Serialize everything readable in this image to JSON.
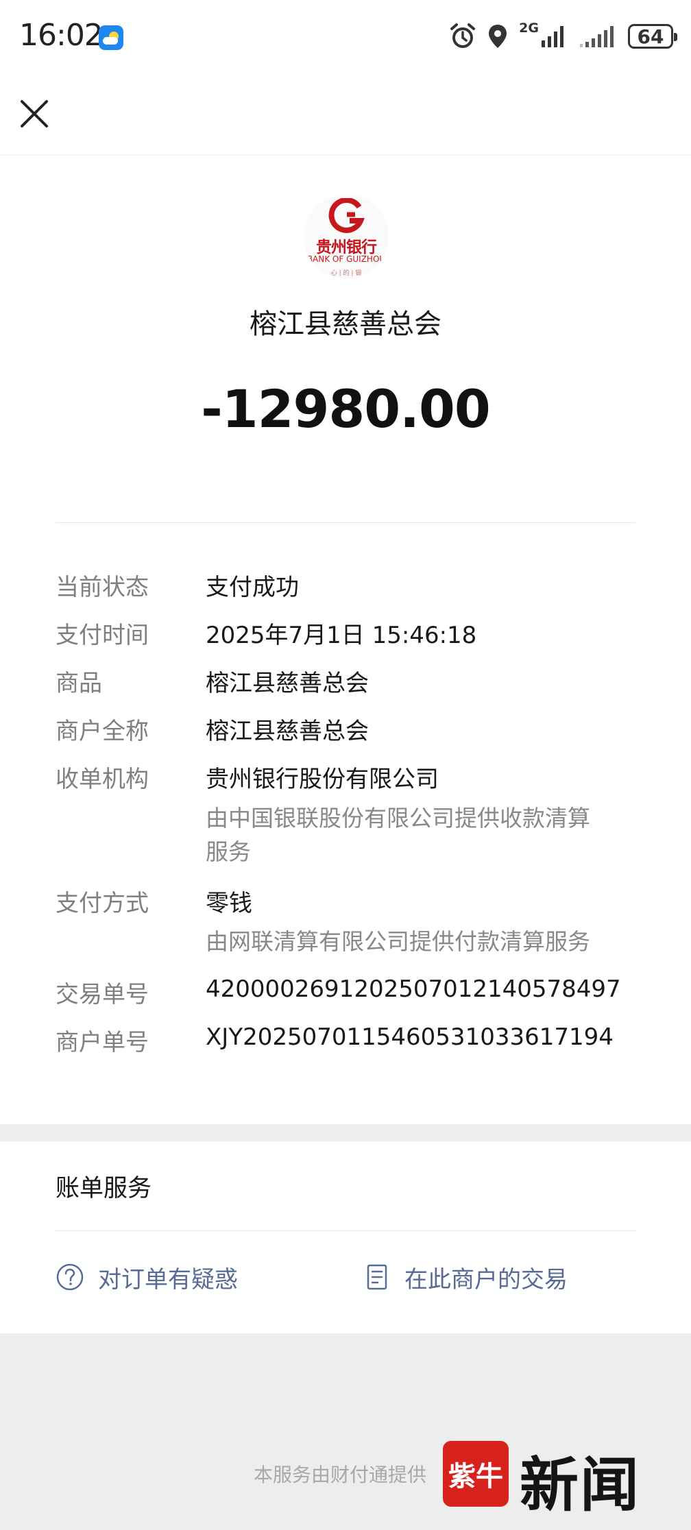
{
  "status_bar": {
    "time": "16:02",
    "network": "2G",
    "battery": "64"
  },
  "top_bar": {
    "close_icon": "close-icon"
  },
  "receipt": {
    "merchant_logo": {
      "name": "贵州银行",
      "english": "BANK OF GUIZHOU",
      "sub": "心 | 的 | 银"
    },
    "merchant_name": "榕江县慈善总会",
    "amount": "-12980.00",
    "rows": [
      {
        "label": "当前状态",
        "value": "支付成功"
      },
      {
        "label": "支付时间",
        "value": "2025年7月1日 15:46:18"
      },
      {
        "label": "商品",
        "value": "榕江县慈善总会"
      },
      {
        "label": "商户全称",
        "value": "榕江县慈善总会"
      },
      {
        "label": "收单机构",
        "value": "贵州银行股份有限公司",
        "note_line1": "由中国银联股份有限公司提供收款清算",
        "note_line2": "服务"
      },
      {
        "label": "支付方式",
        "value": "零钱",
        "note": "由网联清算有限公司提供付款清算服务"
      },
      {
        "label": "交易单号",
        "value": "4200002691202507012140578497"
      },
      {
        "label": "商户单号",
        "value": "XJY2025070115460531033617194"
      }
    ]
  },
  "bill_services": {
    "title": "账单服务",
    "doubt_label": "对订单有疑惑",
    "merchant_tx_label": "在此商户的交易"
  },
  "footer": {
    "provider": "本服务由财付通提供"
  },
  "watermark": {
    "badge": "紫牛",
    "text": "新闻"
  },
  "colors": {
    "link": "#576b95",
    "bank_red": "#c7171e",
    "background": "#ededed"
  }
}
